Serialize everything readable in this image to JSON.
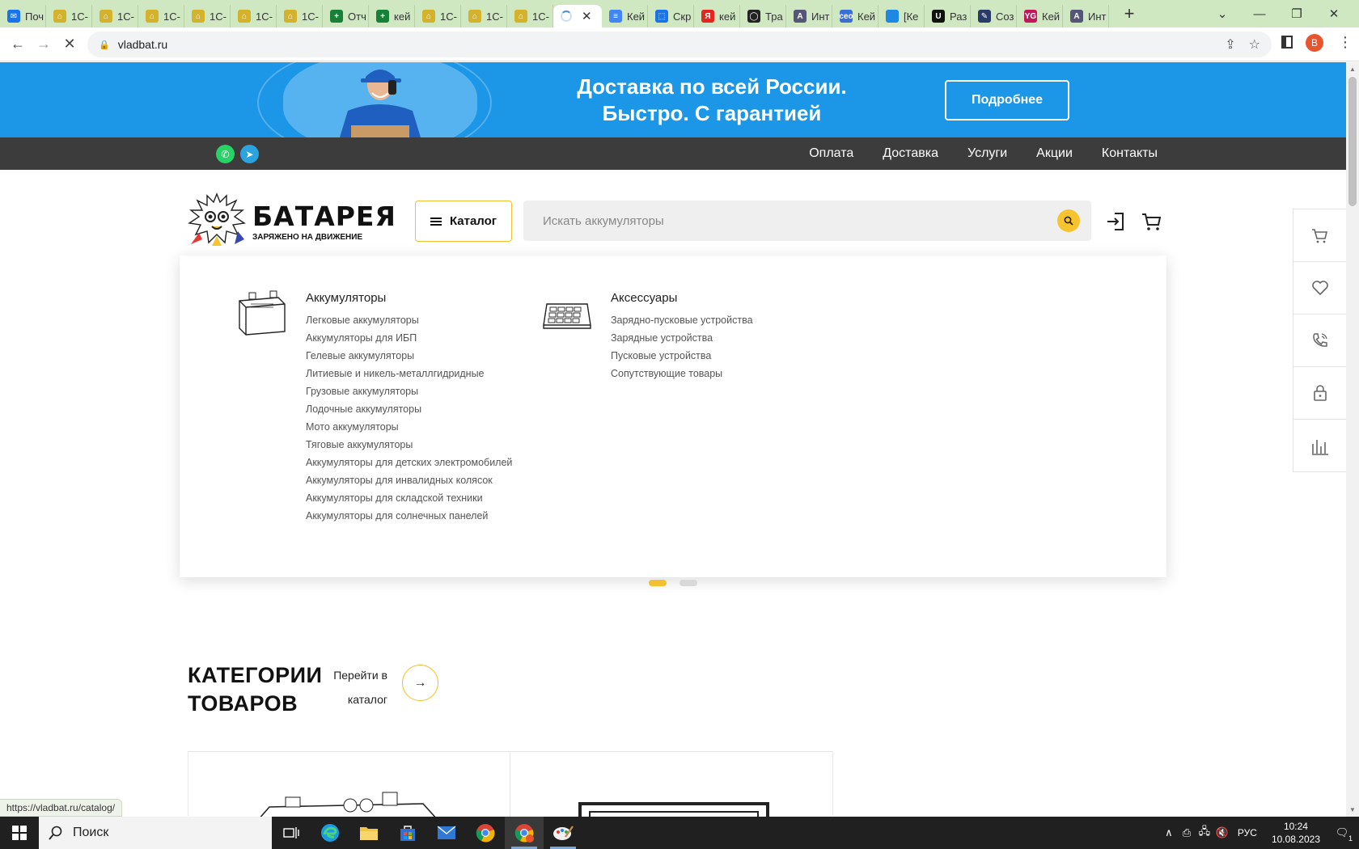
{
  "browser": {
    "tabs": [
      {
        "label": "Поч",
        "color": "#1a73e8",
        "glyph": "✉"
      },
      {
        "label": "1С-",
        "color": "#d4b22c",
        "glyph": "⌂"
      },
      {
        "label": "1С-",
        "color": "#d4b22c",
        "glyph": "⌂"
      },
      {
        "label": "1С-",
        "color": "#d4b22c",
        "glyph": "⌂"
      },
      {
        "label": "1С-",
        "color": "#d4b22c",
        "glyph": "⌂"
      },
      {
        "label": "1С-",
        "color": "#d4b22c",
        "glyph": "⌂"
      },
      {
        "label": "1С-",
        "color": "#d4b22c",
        "glyph": "⌂"
      },
      {
        "label": "Отч",
        "color": "#188038",
        "glyph": "+"
      },
      {
        "label": "кей",
        "color": "#188038",
        "glyph": "+"
      },
      {
        "label": "1С-",
        "color": "#d4b22c",
        "glyph": "⌂"
      },
      {
        "label": "1С-",
        "color": "#d4b22c",
        "glyph": "⌂"
      },
      {
        "label": "1С-",
        "color": "#d4b22c",
        "glyph": "⌂"
      }
    ],
    "tabs_after": [
      {
        "label": "Кей",
        "color": "#4285f4",
        "glyph": "≡"
      },
      {
        "label": "Скр",
        "color": "#1a73e8",
        "glyph": "⬚"
      },
      {
        "label": "кей",
        "color": "#e52620",
        "glyph": "Я"
      },
      {
        "label": "Тра",
        "color": "#222222",
        "glyph": "◯"
      },
      {
        "label": "Инт",
        "color": "#555577",
        "glyph": "A"
      },
      {
        "label": "Кей",
        "color": "#3b6fd6",
        "glyph": "ceo"
      },
      {
        "label": "[Ке",
        "color": "#1e88e5",
        "glyph": " "
      },
      {
        "label": "Раз",
        "color": "#111111",
        "glyph": "U"
      },
      {
        "label": "Соз",
        "color": "#2a3b6a",
        "glyph": "✎"
      },
      {
        "label": "Кей",
        "color": "#c2185b",
        "glyph": "YG"
      },
      {
        "label": "Инт",
        "color": "#555577",
        "glyph": "A"
      }
    ],
    "active_tab_close": "✕",
    "new_tab": "+",
    "url": "vladbat.ru",
    "profile_initial": "В",
    "status_url": "https://vladbat.ru/catalog/"
  },
  "banner": {
    "line1": "Доставка по всей России.",
    "line2": "Быстро. С гарантией",
    "button": "Подробнее"
  },
  "topnav": {
    "links": [
      "Оплата",
      "Доставка",
      "Услуги",
      "Акции",
      "Контакты"
    ]
  },
  "header": {
    "logo_title": "БАТАРЕЯ",
    "logo_sub": "ЗАРЯЖЕНО НА ДВИЖЕНИЕ",
    "catalog_label": "Каталог",
    "search_placeholder": "Искать аккумуляторы"
  },
  "mega_menu": {
    "col1": {
      "title": "Аккумуляторы",
      "items": [
        "Легковые аккумуляторы",
        "Аккумуляторы для ИБП",
        "Гелевые аккумуляторы",
        "Литиевые и никель-металлгидридные",
        "Грузовые аккумуляторы",
        "Лодочные аккумуляторы",
        "Мото аккумуляторы",
        "Тяговые аккумуляторы",
        "Аккумуляторы для детских электромобилей",
        "Аккумуляторы для инвалидных колясок",
        "Аккумуляторы для складской техники",
        "Аккумуляторы для солнечных панелей"
      ]
    },
    "col2": {
      "title": "Аксессуары",
      "items": [
        "Зарядно-пусковые устройства",
        "Зарядные устройства",
        "Пусковые устройства",
        "Сопутствующие товары"
      ]
    }
  },
  "categories": {
    "title_line1": "КАТЕГОРИИ",
    "title_line2": "ТОВАРОВ",
    "link_line1": "Перейти в",
    "link_line2": "каталог",
    "arrow": "→"
  },
  "taskbar": {
    "search_label": "Поиск",
    "lang": "РУС",
    "time": "10:24",
    "date": "10.08.2023",
    "notif_count": "1"
  },
  "colors": {
    "banner_blue": "#1c96e6",
    "accent_yellow": "#f7c42f",
    "nav_dark": "#3c3c3c"
  }
}
